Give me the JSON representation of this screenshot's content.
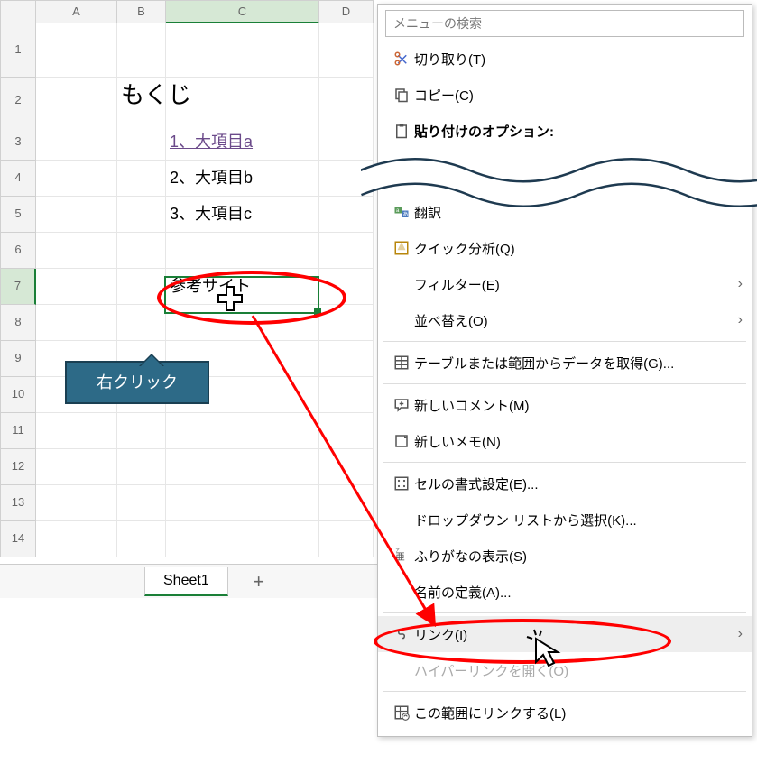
{
  "sheet": {
    "columns": [
      "A",
      "B",
      "C",
      "D"
    ],
    "active_col": "C",
    "rows": [
      "1",
      "2",
      "3",
      "4",
      "5",
      "6",
      "7",
      "8",
      "9",
      "10",
      "11",
      "12",
      "13",
      "14"
    ],
    "active_row": "7",
    "cells": {
      "B2": "もくじ",
      "C3": "1、大項目a",
      "C4": "2、大項目b",
      "C5": "3、大項目c",
      "C7": "参考サイト"
    },
    "tab": "Sheet1"
  },
  "callout": "右クリック",
  "menu": {
    "search_placeholder": "メニューの検索",
    "cut": "切り取り(T)",
    "copy": "コピー(C)",
    "paste_options": "貼り付けのオプション:",
    "translate": "翻訳",
    "quick_analysis": "クイック分析(Q)",
    "filter": "フィルター(E)",
    "sort": "並べ替え(O)",
    "get_data": "テーブルまたは範囲からデータを取得(G)...",
    "new_comment": "新しいコメント(M)",
    "new_note": "新しいメモ(N)",
    "format_cells": "セルの書式設定(E)...",
    "dropdown": "ドロップダウン リストから選択(K)...",
    "furigana": "ふりがなの表示(S)",
    "define_name": "名前の定義(A)...",
    "link": "リンク(I)",
    "open_hyperlink": "ハイパーリンクを開く(O)",
    "link_range": "この範囲にリンクする(L)"
  }
}
